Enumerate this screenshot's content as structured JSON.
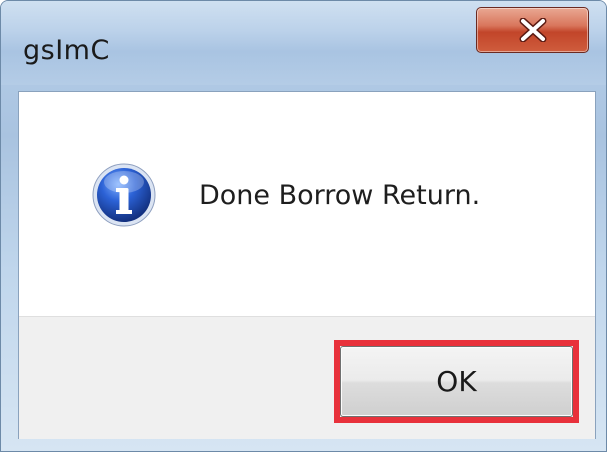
{
  "window": {
    "title": "gsImC"
  },
  "message": {
    "text": "Done Borrow Return.",
    "icon": "info-icon"
  },
  "buttons": {
    "ok_label": "OK",
    "close_icon": "close-icon"
  },
  "colors": {
    "highlight": "#e8313b",
    "close_button": "#c2452a",
    "info_icon": "#1f4fb8"
  }
}
